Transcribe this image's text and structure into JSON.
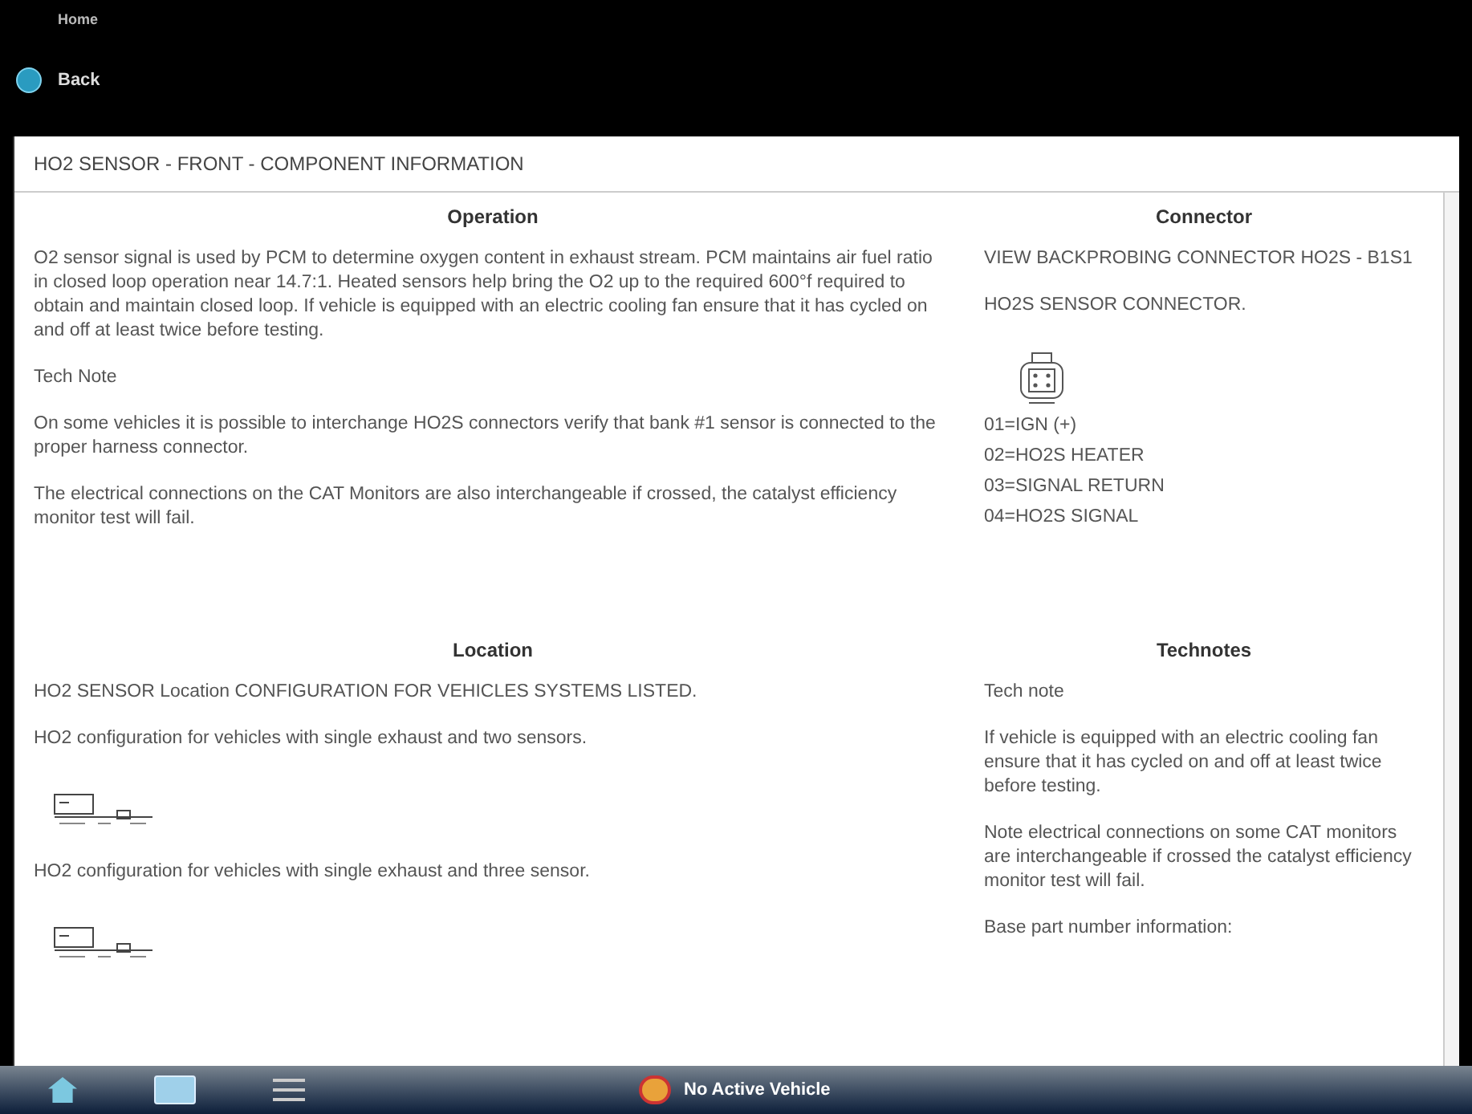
{
  "header": {
    "home": "Home",
    "back": "Back"
  },
  "page_title": "HO2 SENSOR - FRONT - COMPONENT INFORMATION",
  "operation": {
    "heading": "Operation",
    "paragraphs": [
      "O2 sensor signal is used by PCM to determine oxygen content in exhaust stream. PCM maintains air fuel ratio in closed loop operation near 14.7:1. Heated sensors help bring the O2 up to the required 600°f required to obtain and maintain closed loop. If vehicle is equipped with an electric cooling fan ensure that it has cycled on and off at least twice before testing.",
      "Tech Note",
      "On some vehicles it is possible to interchange HO2S connectors verify that bank #1 sensor is connected to the proper harness connector.",
      "The electrical connections on the CAT Monitors are also interchangeable if crossed, the catalyst efficiency monitor test will fail."
    ]
  },
  "connector": {
    "heading": "Connector",
    "lines_top": [
      "VIEW BACKPROBING CONNECTOR HO2S - B1S1",
      "HO2S SENSOR CONNECTOR."
    ],
    "pins": [
      "01=IGN (+)",
      "02=HO2S HEATER",
      "03=SIGNAL RETURN",
      "04=HO2S SIGNAL"
    ]
  },
  "location": {
    "heading": "Location",
    "items": [
      {
        "kind": "text",
        "text": "HO2 SENSOR Location CONFIGURATION FOR VEHICLES SYSTEMS LISTED."
      },
      {
        "kind": "text",
        "text": "HO2 configuration for vehicles with single exhaust and two sensors."
      },
      {
        "kind": "diagram"
      },
      {
        "kind": "text",
        "text": "HO2 configuration for vehicles with single exhaust and three sensor."
      },
      {
        "kind": "diagram"
      }
    ]
  },
  "technotes": {
    "heading": "Technotes",
    "paragraphs": [
      "Tech note",
      "If vehicle is equipped with an electric cooling fan ensure that it has cycled on and off at least twice before testing.",
      "Note electrical connections on some CAT monitors are interchangeable if crossed the catalyst efficiency monitor test will fail.",
      "Base part number information:"
    ]
  },
  "taskbar": {
    "status": "No Active Vehicle"
  }
}
